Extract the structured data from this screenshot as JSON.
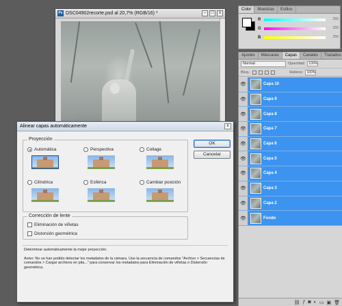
{
  "document": {
    "ps_badge": "Ps",
    "title": "DSC04902recorte.psd al 20,7% (RGB/16) *",
    "minimize": "–",
    "maximize": "□",
    "close": "x"
  },
  "color_panel": {
    "tabs": [
      "Color",
      "Muestras",
      "Estilos"
    ],
    "sliders": [
      {
        "label": "R",
        "value": "255",
        "gradient": "linear-gradient(90deg,#0ff,#fff)"
      },
      {
        "label": "G",
        "value": "255",
        "gradient": "linear-gradient(90deg,#f0f,#fff)"
      },
      {
        "label": "B",
        "value": "255",
        "gradient": "linear-gradient(90deg,#ff0,#fff)"
      }
    ]
  },
  "layers_panel": {
    "tabs": [
      "Ajustes",
      "Máscaras",
      "Capas",
      "Canales",
      "Trazados"
    ],
    "blend_mode": "Normal",
    "opacity_label": "Opacidad:",
    "opacity_value": "100%",
    "lock_label": "Bloq.:",
    "fill_label": "Relleno:",
    "fill_value": "100%",
    "layers": [
      "Capa 10",
      "Capa 9",
      "Capa 8",
      "Capa 7",
      "Capa 6",
      "Capa 5",
      "Capa 4",
      "Capa 3",
      "Capa 2",
      "Fondo"
    ]
  },
  "dialog": {
    "title": "Alinear capas automáticamente",
    "projection_legend": "Proyección",
    "options": {
      "auto": "Automática",
      "perspective": "Perspectiva",
      "collage": "Collage",
      "cylindrical": "Cilíndrica",
      "spherical": "Esférica",
      "reposition": "Cambiar posición"
    },
    "lens_legend": "Corrección de lente",
    "vignette": "Eliminación de viñetas",
    "distortion": "Distorsión geométrica",
    "ok": "OK",
    "cancel": "Cancelar",
    "info_line1": "Determinar automáticamente la mejor proyección.",
    "info_line2": "Aviso: No se han podido detectar los metadatos de la cámara. Use la secuencia de comandos \"Archivo > Secuencias de comandos > Cargar archivos en pila...\" para conservar los metadatos para Eliminación de viñetas o Distorsión geométrica."
  }
}
